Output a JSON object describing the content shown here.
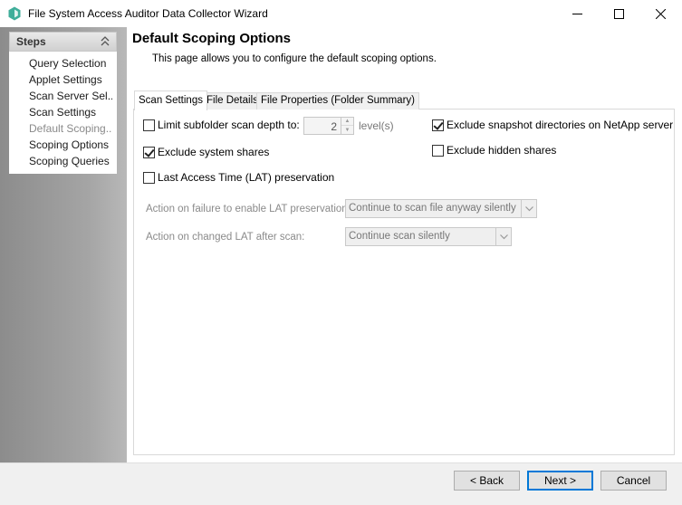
{
  "window": {
    "title": "File System Access Auditor Data Collector Wizard",
    "icon": "app-hexagon-icon",
    "accent_color": "#3fae9a"
  },
  "sidebar": {
    "header": "Steps",
    "items": [
      {
        "label": "Query Selection"
      },
      {
        "label": "Applet Settings"
      },
      {
        "label": "Scan Server Sel..."
      },
      {
        "label": "Scan Settings"
      },
      {
        "label": "Default Scoping..."
      },
      {
        "label": "Scoping Options"
      },
      {
        "label": "Scoping Queries"
      }
    ],
    "current_index": 4
  },
  "page": {
    "title": "Default Scoping Options",
    "subtitle": "This page allows you to configure the default scoping options."
  },
  "tabs": [
    {
      "label": "Scan Settings",
      "active": true
    },
    {
      "label": "File Details",
      "active": false
    },
    {
      "label": "File Properties (Folder Summary)",
      "active": false
    }
  ],
  "scan_settings": {
    "limit_depth": {
      "label": "Limit subfolder scan depth to:",
      "checked": false
    },
    "depth_value": "2",
    "depth_unit": "level(s)",
    "exclude_snapshot": {
      "label": "Exclude snapshot directories on NetApp server",
      "checked": true
    },
    "exclude_system": {
      "label": "Exclude system shares",
      "checked": true
    },
    "exclude_hidden": {
      "label": "Exclude hidden shares",
      "checked": false
    },
    "lat_preservation": {
      "label": "Last Access Time (LAT) preservation",
      "checked": false
    },
    "action_failure": {
      "label": "Action on failure to enable LAT preservation:",
      "value": "Continue to scan file anyway silently"
    },
    "action_changed": {
      "label": "Action on changed LAT after scan:",
      "value": "Continue scan silently"
    }
  },
  "buttons": {
    "back": "< Back",
    "next": "Next >",
    "cancel": "Cancel"
  }
}
